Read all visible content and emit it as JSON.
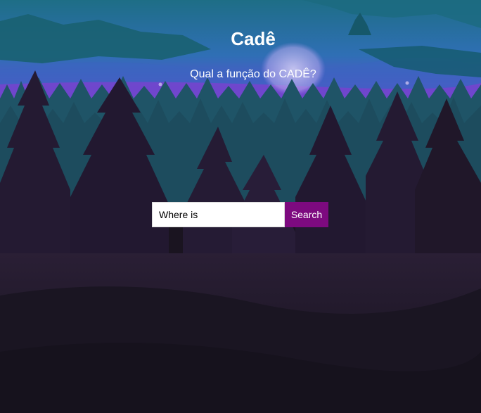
{
  "header": {
    "title": "Cadê",
    "subtitle": "Qual a função do CADÊ?"
  },
  "search": {
    "value": "Where is",
    "button_label": "Search"
  },
  "colors": {
    "button_bg": "#7d0a7f",
    "sky_top": "#1e6e86",
    "sky_purple": "#7a3fcf",
    "forest_dark": "#1a1420"
  }
}
